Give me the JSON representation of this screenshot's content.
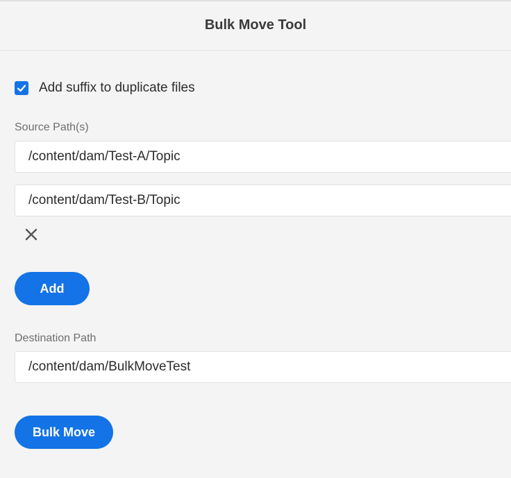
{
  "header": {
    "title": "Bulk Move Tool"
  },
  "options": {
    "add_suffix_label": "Add suffix to duplicate files",
    "add_suffix_checked": true
  },
  "source": {
    "label": "Source Path(s)",
    "paths": [
      "/content/dam/Test-A/Topic",
      "/content/dam/Test-B/Topic"
    ],
    "add_label": "Add"
  },
  "destination": {
    "label": "Destination Path",
    "path": "/content/dam/BulkMoveTest"
  },
  "actions": {
    "bulk_move_label": "Bulk Move"
  },
  "colors": {
    "accent": "#1473e6",
    "background": "#f4f4f4"
  },
  "icons": {
    "checkbox": "checkmark-icon",
    "remove": "close-icon"
  }
}
